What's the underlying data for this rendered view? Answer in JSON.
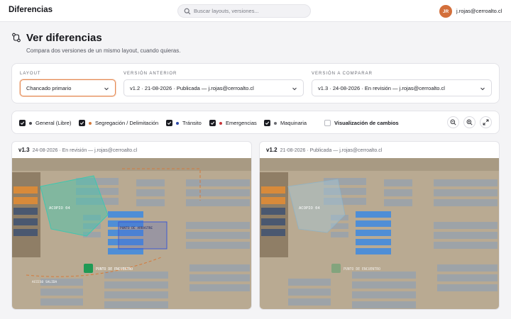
{
  "app": {
    "title": "Diferencias"
  },
  "search": {
    "placeholder": "Buscar layouts, versiones..."
  },
  "user": {
    "initials": "JR",
    "email": "j.rojas@cerroalto.cl"
  },
  "header": {
    "title": "Ver diferencias",
    "subtitle": "Compara dos versiones de un mismo layout, cuando quieras."
  },
  "selectors": {
    "layout": {
      "label": "LAYOUT",
      "value": "Chancado primario"
    },
    "previous": {
      "label": "VERSIÓN ANTERIOR",
      "value": "v1.2 · 21-08-2026 · Publicada — j.rojas@cerroalto.cl"
    },
    "compare": {
      "label": "VERSIÓN A COMPARAR",
      "value": "v1.3 · 24-08-2026 · En revisión — j.rojas@cerroalto.cl"
    }
  },
  "filters": [
    {
      "label": "General (Libre)",
      "checked": true,
      "color": "#4a4b52"
    },
    {
      "label": "Segregación / Delimitación",
      "checked": true,
      "color": "#d47a3c"
    },
    {
      "label": "Tránsito",
      "checked": true,
      "color": "#2d4aa8"
    },
    {
      "label": "Emergencias",
      "checked": true,
      "color": "#c6363a"
    },
    {
      "label": "Maquinaria",
      "checked": true,
      "color": "#6b6c73"
    },
    {
      "label": "Visualización de cambios",
      "checked": false
    }
  ],
  "tools": [
    "zoom-out-icon",
    "zoom-in-icon",
    "expand-icon"
  ],
  "panels": {
    "left": {
      "version": "v1.3",
      "meta": "24-08-2026 · En revisión — j.rojas@cerroalto.cl",
      "labels": {
        "acopio": "ACOPIO 04",
        "encuentro": "PUNTO DE ENCUENTRO",
        "acceso": "PUNTO DE ARRASTRE",
        "salida": "ACCESO SALIDA"
      }
    },
    "right": {
      "version": "v1.2",
      "meta": "21-08-2026 · Publicada — j.rojas@cerroalto.cl",
      "labels": {
        "acopio": "ACOPIO 04",
        "encuentro": "PUNTO DE ENCUENTRO"
      }
    }
  },
  "colors": {
    "accent": "#d36f3b",
    "zone_teal": "#3ec7b0",
    "zone_blue": "#3e5bd1",
    "meeting_green": "#1f9a55"
  }
}
